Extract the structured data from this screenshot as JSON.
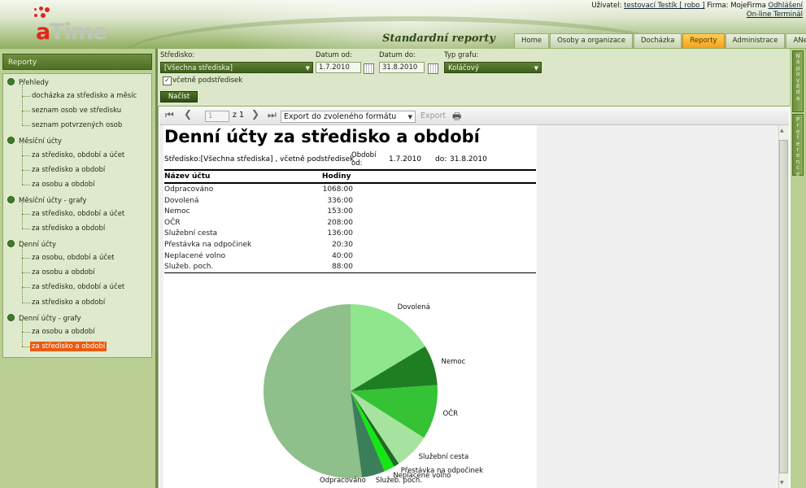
{
  "header": {
    "user_label": "Uživatel:",
    "user_link": "testovací Testík [ robo ]",
    "firm_label": "Firma: MojeFirma",
    "logout_link": "Odhlášení",
    "terminal_link": "On-line Terminál",
    "page_title": "Standardní reporty",
    "logo_a": "a",
    "logo_rest": "Time"
  },
  "nav": {
    "tabs": [
      {
        "label": "Home"
      },
      {
        "label": "Osoby a organizace"
      },
      {
        "label": "Docházka"
      },
      {
        "label": "Reporty",
        "active": true
      },
      {
        "label": "Administrace"
      },
      {
        "label": "ANeT"
      }
    ]
  },
  "left_panel": {
    "title": "Reporty",
    "groups": [
      {
        "label": "Přehledy",
        "items": [
          "docházka za středisko a měsíc",
          "seznam osob ve středisku",
          "seznam potvrzených osob"
        ]
      },
      {
        "label": "Měsíční účty",
        "items": [
          "za středisko, období a účet",
          "za středisko a období",
          "za osobu a období"
        ]
      },
      {
        "label": "Měsíční účty - grafy",
        "items": [
          "za středisko, období a účet",
          "za středisko a období"
        ]
      },
      {
        "label": "Denní účty",
        "items": [
          "za osobu, období a účet",
          "za osobu a období",
          "za středisko, období a účet",
          "za středisko a období"
        ]
      },
      {
        "label": "Denní účty - grafy",
        "items": [
          "za osobu a období",
          "za středisko a období"
        ]
      }
    ],
    "selected_group": 4,
    "selected_item": 1
  },
  "filters": {
    "stredisko_label": "Středisko:",
    "stredisko_value": "[Všechna střediska]",
    "date_from_label": "Datum od:",
    "date_from_value": "1.7.2010",
    "date_to_label": "Datum do:",
    "date_to_value": "31.8.2010",
    "chart_type_label": "Typ grafu:",
    "chart_type_value": "Koláčový",
    "include_sub_label": "včetně podstředisek",
    "include_sub_checked": true,
    "load_button": "Načíst"
  },
  "right_strip": {
    "tab1": "Nápověda",
    "tab2": "Preference"
  },
  "toolbar": {
    "page_current": "1",
    "page_of": "z 1",
    "export_format": "Export do zvoleného formátu",
    "export_button": "Export"
  },
  "report": {
    "title": "Denní účty za středisko a období",
    "stredisko_line": "Středisko:[Všechna střediska] , včetně podstředisek",
    "obdobi_od_label": "Období od:",
    "obdobi_od_value": "1.7.2010",
    "do_label": "do:",
    "do_value": "31.8.2010",
    "col_name": "Název účtu",
    "col_hours": "Hodiny",
    "rows": [
      {
        "name": "Odpracováno",
        "hours": "1068:00"
      },
      {
        "name": "Dovolená",
        "hours": "336:00"
      },
      {
        "name": "Nemoc",
        "hours": "153:00"
      },
      {
        "name": "OČR",
        "hours": "208:00"
      },
      {
        "name": "Služební cesta",
        "hours": "136:00"
      },
      {
        "name": "Přestávka na odpočinek",
        "hours": "20:30"
      },
      {
        "name": "Neplacené volno",
        "hours": "40:00"
      },
      {
        "name": "Služeb. poch.",
        "hours": "88:00"
      }
    ]
  },
  "chart_data": {
    "type": "pie",
    "categories": [
      "Odpracováno",
      "Dovolená",
      "Nemoc",
      "OČR",
      "Služební cesta",
      "Přestávka na odpočinek",
      "Neplacené volno",
      "Služeb. poch."
    ],
    "values": [
      1068,
      336,
      153,
      208,
      136,
      20.5,
      40,
      88
    ],
    "colors": [
      "#8fbf8a",
      "#8fe68c",
      "#1e7f22",
      "#35c235",
      "#a6e39e",
      "#1f6b1f",
      "#15e615",
      "#3a7f5a"
    ]
  }
}
